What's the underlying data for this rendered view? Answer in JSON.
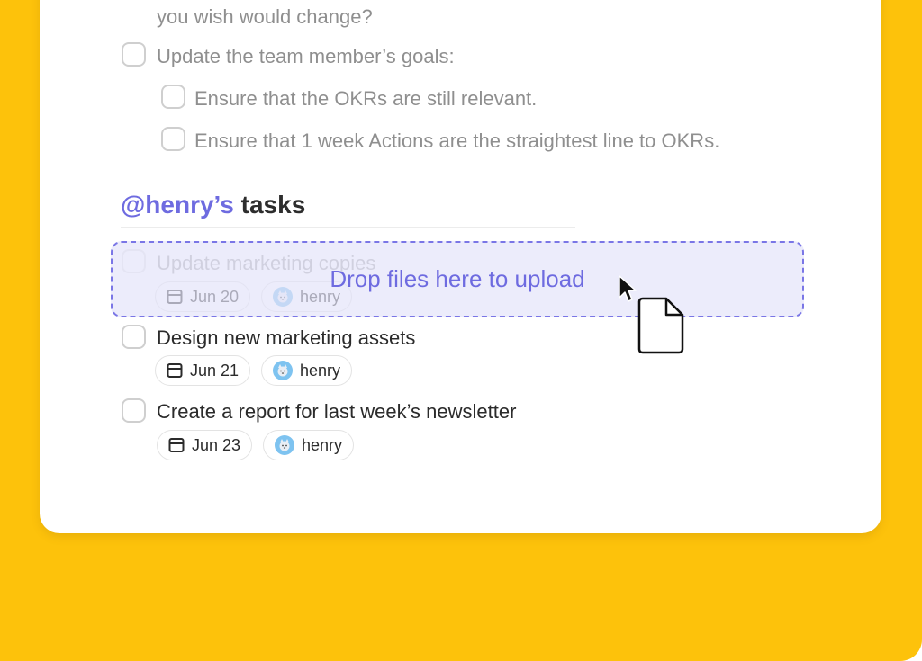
{
  "checklist": {
    "top_fragment": "you wish would change?",
    "goals_label": "Update the team member’s goals:",
    "sub_items": [
      "Ensure that the OKRs are still relevant.",
      "Ensure that 1 week Actions are the straightest line to OKRs."
    ]
  },
  "tasks_section": {
    "mention": "@henry’s",
    "title_rest": " tasks"
  },
  "tasks": [
    {
      "label": "Update marketing copies",
      "date": "Jun 20",
      "assignee": "henry",
      "state": "behind-dropzone"
    },
    {
      "label": "Design new marketing assets",
      "date": "Jun 21",
      "assignee": "henry"
    },
    {
      "label": "Create a report for last week’s newsletter",
      "date": "Jun 23",
      "assignee": "henry"
    }
  ],
  "dropzone": {
    "label": "Drop files here to upload"
  },
  "icons": {
    "date": "calendar-icon",
    "assignee": "avatar-icon",
    "cursor": "arrow-cursor-icon",
    "dragged_item": "file-icon"
  },
  "colors": {
    "background": "#FDC20B",
    "accent": "#6E6BE0",
    "card": "#FFFFFF"
  }
}
